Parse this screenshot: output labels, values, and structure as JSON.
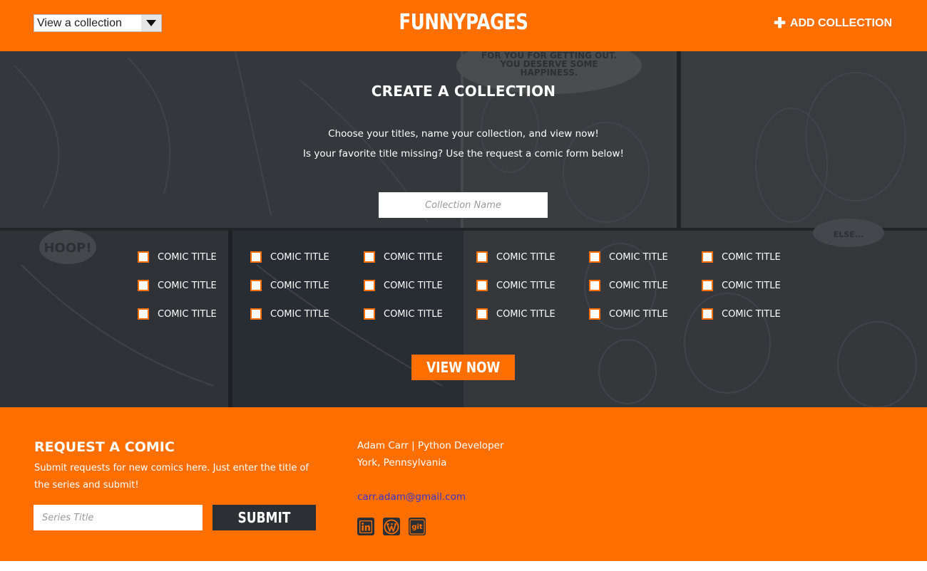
{
  "header": {
    "select_value": "View a collection",
    "logo": "FUNNYPAGES",
    "add_collection": "ADD COLLECTION"
  },
  "hero": {
    "title": "CREATE A COLLECTION",
    "subtitle_1": "Choose your titles, name your collection, and view now!",
    "subtitle_2": "Is your favorite title missing?  Use the request a comic form below!",
    "collection_placeholder": "Collection Name",
    "comic_rows": [
      [
        "COMIC TITLE",
        "COMIC TITLE",
        "COMIC TITLE",
        "COMIC TITLE",
        "COMIC TITLE",
        "COMIC TITLE"
      ],
      [
        "COMIC TITLE",
        "COMIC TITLE",
        "COMIC TITLE",
        "COMIC TITLE",
        "COMIC TITLE",
        "COMIC TITLE"
      ],
      [
        "COMIC TITLE",
        "COMIC TITLE",
        "COMIC TITLE",
        "COMIC TITLE",
        "COMIC TITLE",
        "COMIC TITLE"
      ]
    ],
    "view_now": "VIEW NOW",
    "art_text": [
      "FOR YOU FOR GETTING OUT.",
      "YOU DESERVE SOME",
      "HAPPINESS.",
      "HOOP!",
      "ELSE..."
    ]
  },
  "footer": {
    "request_title": "REQUEST A COMIC",
    "request_desc": "Submit requests for new comics here.  Just enter the title of the series and submit!",
    "series_placeholder": "Series Title",
    "submit": "SUBMIT",
    "dev_line_1": "Adam Carr | Python Developer",
    "dev_line_2": "York, Pennsylvania",
    "email": "carr.adam@gmail.com",
    "social_icons": [
      "linkedin-icon",
      "wordpress-icon",
      "git-icon"
    ],
    "git_label": "git"
  },
  "colors": {
    "brand_orange": "#ff6f00",
    "dark": "#2c2f34",
    "link": "#3a33c9"
  }
}
